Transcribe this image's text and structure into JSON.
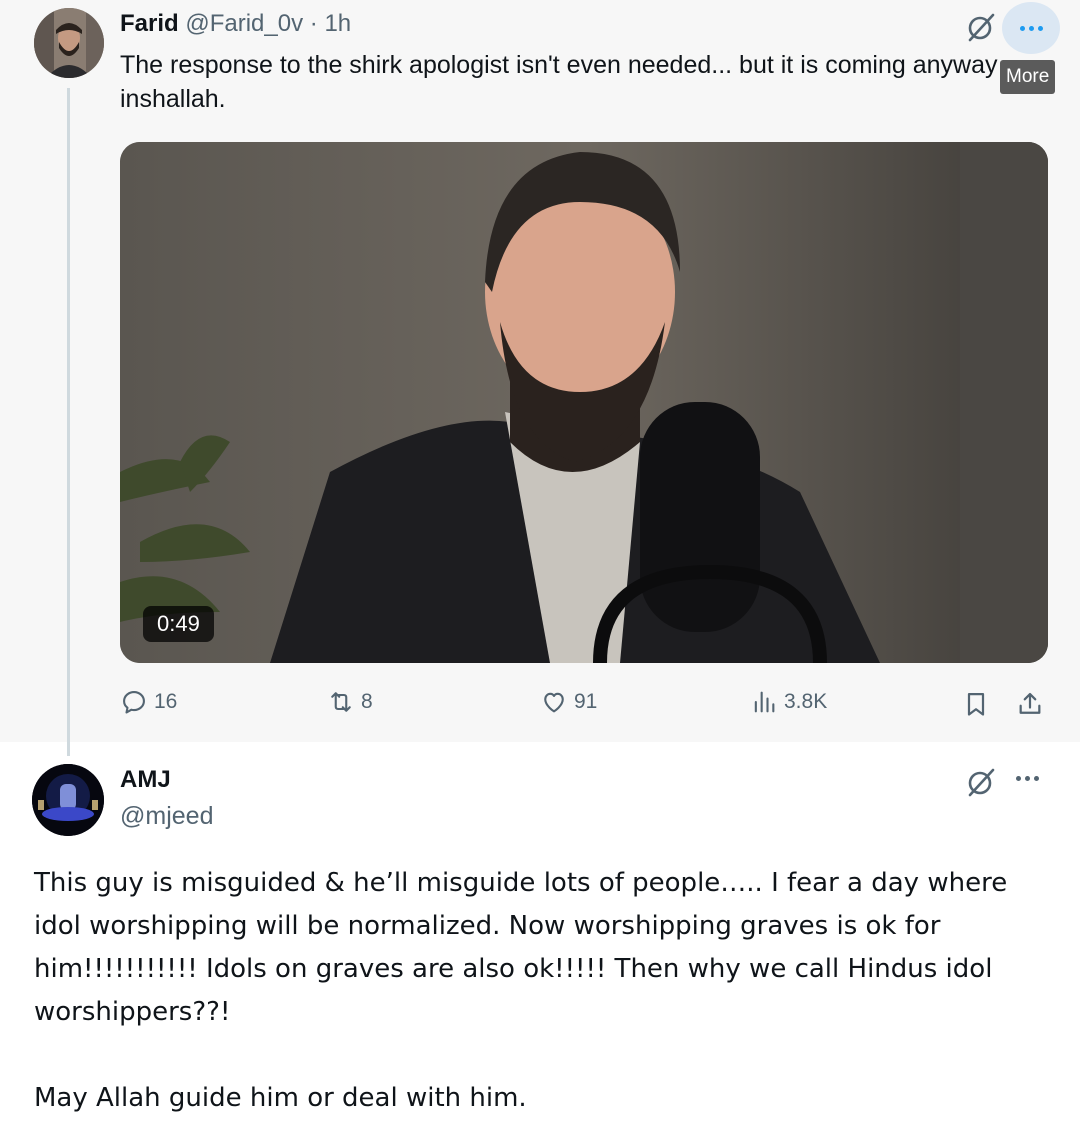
{
  "tweet": {
    "author_name": "Farid",
    "author_handle": "@Farid_0v",
    "separator": "·",
    "time": "1h",
    "text": "The response to the shirk apologist isn't even needed... but it is coming anyway inshallah.",
    "more_tooltip": "More",
    "video_duration": "0:49",
    "stats": {
      "replies": "16",
      "reposts": "8",
      "likes": "91",
      "views": "3.8K"
    }
  },
  "reply": {
    "author_name": "AMJ",
    "author_handle": "@mjeed",
    "paragraph1": "This guy is misguided & he’ll misguide lots of people….. I fear a day where idol worshipping will be normalized. Now worshipping graves is ok for him!!!!!!!!!!! Idols on graves are also ok!!!!! Then why we call Hindus idol worshippers??!",
    "paragraph2": "May Allah guide him or deal with him."
  },
  "colors": {
    "text_primary": "#0f1419",
    "text_secondary": "#536471",
    "accent": "#1d9bf0",
    "thread_line": "#cfd9de"
  },
  "icons": [
    "grok-icon",
    "more-icon",
    "reply-icon",
    "repost-icon",
    "like-icon",
    "views-icon",
    "bookmark-icon",
    "share-icon"
  ]
}
